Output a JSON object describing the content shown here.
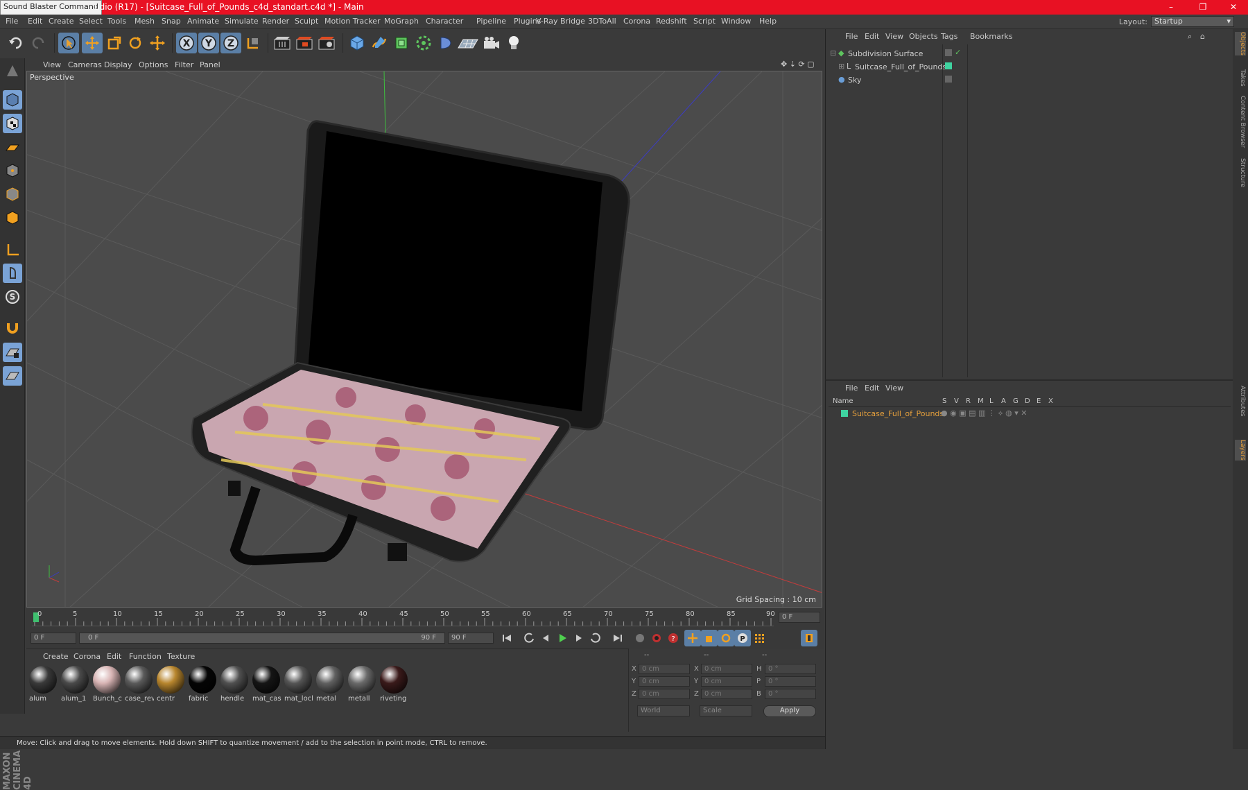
{
  "titlebar": {
    "overlay_tag": "Sound Blaster Command",
    "title": "udio (R17) - [Suitcase_Full_of_Pounds_c4d_standart.c4d *] - Main",
    "minimize": "–",
    "restore": "❐",
    "close": "✕"
  },
  "menu": [
    "File",
    "Edit",
    "Create",
    "Select",
    "Tools",
    "Mesh",
    "Snap",
    "Animate",
    "Simulate",
    "Render",
    "Sculpt",
    "Motion Tracker",
    "MoGraph",
    "Character",
    "Pipeline",
    "Plugins",
    "V-Ray Bridge",
    "3DToAll",
    "Corona",
    "Redshift",
    "Script",
    "Window",
    "Help"
  ],
  "layout": {
    "label": "Layout:",
    "value": "Startup"
  },
  "viewport": {
    "menu": [
      "View",
      "Cameras",
      "Display",
      "Options",
      "Filter",
      "Panel"
    ],
    "label": "Perspective",
    "grid_spacing": "Grid Spacing : 10 cm"
  },
  "timeline": {
    "ticks": [
      "0",
      "5",
      "10",
      "15",
      "20",
      "25",
      "30",
      "35",
      "40",
      "45",
      "50",
      "55",
      "60",
      "65",
      "70",
      "75",
      "80",
      "85",
      "90"
    ],
    "current_frame": "0 F",
    "start_field": "0 F",
    "range_start": "0 F",
    "range_end": "90 F",
    "end_field": "90 F"
  },
  "materials": {
    "menu": [
      "Create",
      "Corona",
      "Edit",
      "Function",
      "Texture"
    ],
    "items": [
      {
        "name": "alum",
        "color": "#3a3a3a"
      },
      {
        "name": "alum_1",
        "color": "#4a4a4a"
      },
      {
        "name": "Bunch_c",
        "color": "#d8b4b4"
      },
      {
        "name": "case_rev",
        "color": "#5a5a5a"
      },
      {
        "name": "centr",
        "color": "#b8862e"
      },
      {
        "name": "fabric",
        "color": "#050505"
      },
      {
        "name": "hendle",
        "color": "#505050"
      },
      {
        "name": "mat_cas",
        "color": "#151515"
      },
      {
        "name": "mat_locl",
        "color": "#555"
      },
      {
        "name": "metal",
        "color": "#606060"
      },
      {
        "name": "metall",
        "color": "#6a6a6a"
      },
      {
        "name": "riveting",
        "color": "#3a1a1a"
      }
    ]
  },
  "coords": {
    "headers": [
      "--",
      "--",
      "--"
    ],
    "rows": [
      {
        "a": "X",
        "av": "0 cm",
        "b": "X",
        "bv": "0 cm",
        "c": "H",
        "cv": "0 °"
      },
      {
        "a": "Y",
        "av": "0 cm",
        "b": "Y",
        "bv": "0 cm",
        "c": "P",
        "cv": "0 °"
      },
      {
        "a": "Z",
        "av": "0 cm",
        "b": "Z",
        "bv": "0 cm",
        "c": "B",
        "cv": "0 °"
      }
    ],
    "mode1": "World",
    "mode2": "Scale",
    "apply": "Apply"
  },
  "status": "Move: Click and drag to move elements. Hold down SHIFT to quantize movement / add to the selection in point mode, CTRL to remove.",
  "object_manager": {
    "menu": [
      "File",
      "Edit",
      "View",
      "Objects",
      "Tags",
      "Bookmarks"
    ],
    "objects": [
      "Subdivision Surface",
      "Suitcase_Full_of_Pounds",
      "Sky"
    ]
  },
  "layer_manager": {
    "menu": [
      "File",
      "Edit",
      "View"
    ],
    "columns": [
      "Name",
      "S",
      "V",
      "R",
      "M",
      "L",
      "A",
      "G",
      "D",
      "E",
      "X"
    ],
    "layers": [
      "Suitcase_Full_of_Pounds"
    ]
  },
  "side_tabs": [
    "Objects",
    "Takes",
    "Content Browser",
    "Structure",
    "Attributes",
    "Layers"
  ],
  "colors": {
    "accent": "#e81123",
    "layer_name": "#e6a03c",
    "layer_swatch": "#3fd3a0"
  }
}
